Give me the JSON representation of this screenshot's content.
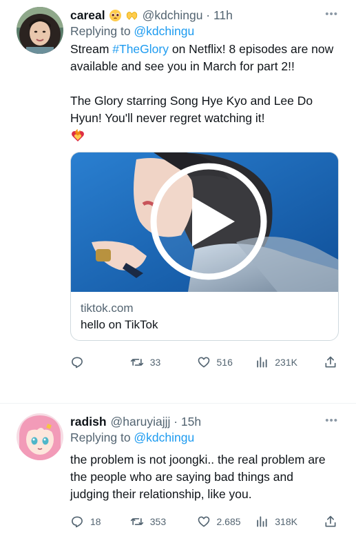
{
  "tweets": [
    {
      "name": "careal",
      "handle": "@kdchingu · 11h",
      "replying_prefix": "Replying to ",
      "replying_to": "@kdchingu",
      "text_before_hashtag": "Stream ",
      "hashtag": "#TheGlory",
      "text_after_hashtag": " on Netflix! 8 episodes are now available and see you in March for part 2!!\n\nThe Glory starring Song Hye Kyo and Lee Do Hyun! You'll never regret watching it!",
      "text_emoji": "❤️‍🔥",
      "card": {
        "domain": "tiktok.com",
        "title": "hello on TikTok"
      },
      "stats": {
        "replies": "",
        "retweets": "33",
        "likes": "516",
        "views": "231K"
      }
    },
    {
      "name": "radish",
      "handle": "@haruyiajjj · 15h",
      "replying_prefix": "Replying to ",
      "replying_to": "@kdchingu",
      "text": "the problem is not joongki.. the real problem are the people who are saying bad things and judging their relationship, like you.",
      "stats": {
        "replies": "18",
        "retweets": "353",
        "likes": "2.685",
        "views": "318K"
      }
    }
  ],
  "icons": {
    "more": "more-options-icon",
    "reply": "reply-icon",
    "retweet": "retweet-icon",
    "like": "heart-icon",
    "views": "views-icon",
    "share": "share-icon",
    "play": "play-icon"
  },
  "colors": {
    "link": "#1d9bf0",
    "secondary": "#536471",
    "text": "#0f1419",
    "border": "#cfd9de"
  }
}
